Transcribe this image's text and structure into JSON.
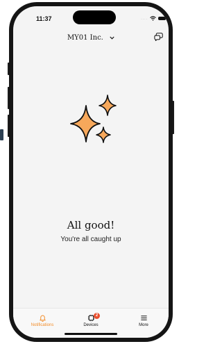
{
  "status": {
    "time": "11:37",
    "signal": "...."
  },
  "header": {
    "org_name": "MY01 Inc."
  },
  "empty_state": {
    "title": "All good!",
    "subtitle": "You're all caught up"
  },
  "tabs": [
    {
      "label": "Notifications",
      "active": true
    },
    {
      "label": "Devices",
      "badge": "2"
    },
    {
      "label": "More"
    }
  ],
  "colors": {
    "accent": "#f28c28",
    "sparkle_fill": "#f7a85b",
    "badge": "#e84e2d"
  }
}
